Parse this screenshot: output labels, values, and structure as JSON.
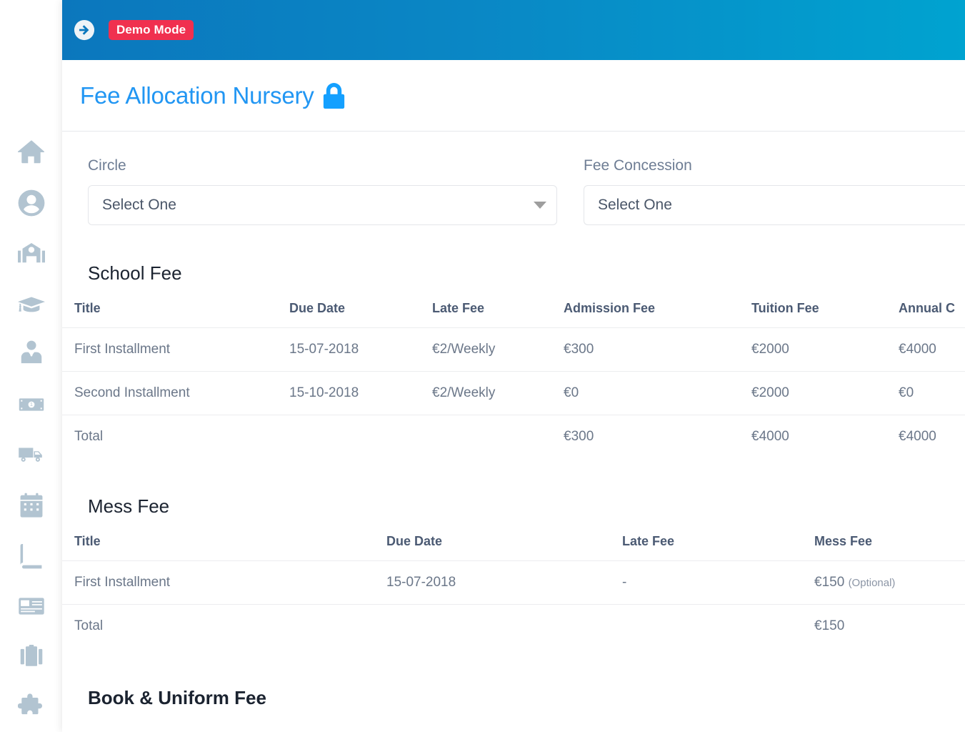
{
  "sidebar": {
    "items": [
      {
        "name": "home",
        "icon": "home-icon"
      },
      {
        "name": "profile",
        "icon": "user-circle-icon"
      },
      {
        "name": "school",
        "icon": "school-building-icon"
      },
      {
        "name": "academics",
        "icon": "graduation-cap-icon"
      },
      {
        "name": "staff",
        "icon": "employee-tie-icon"
      },
      {
        "name": "finance",
        "icon": "money-bill-icon"
      },
      {
        "name": "transport",
        "icon": "truck-icon"
      },
      {
        "name": "calendar",
        "icon": "calendar-icon"
      },
      {
        "name": "library",
        "icon": "book-icon"
      },
      {
        "name": "id-cards",
        "icon": "id-card-icon"
      },
      {
        "name": "inventory",
        "icon": "briefcase-icon"
      },
      {
        "name": "addons",
        "icon": "puzzle-piece-icon"
      }
    ]
  },
  "topbar": {
    "menu_toggle_icon": "arrow-circle-right-icon",
    "demo_badge": "Demo Mode",
    "gradient_start": "#0b77bd",
    "gradient_end": "#00a3d0",
    "badge_color": "#f0304f"
  },
  "header": {
    "title": "Fee Allocation Nursery",
    "title_color": "#2196f3",
    "lock_icon": "lock-icon",
    "lock_color": "#14a0ff"
  },
  "filters": {
    "circle": {
      "label": "Circle",
      "value": "Select One",
      "caret_icon": "chevron-down-icon"
    },
    "fee_concession": {
      "label": "Fee Concession",
      "value": "Select One"
    }
  },
  "school_fee": {
    "title": "School Fee",
    "columns": [
      "Title",
      "Due Date",
      "Late Fee",
      "Admission Fee",
      "Tuition Fee",
      "Annual C"
    ],
    "rows": [
      {
        "title": "First Installment",
        "due_date": "15-07-2018",
        "late_fee": "€2/Weekly",
        "admission_fee": "€300",
        "tuition_fee": "€2000",
        "annual_charges": "€4000"
      },
      {
        "title": "Second Installment",
        "due_date": "15-10-2018",
        "late_fee": "€2/Weekly",
        "admission_fee": "€0",
        "tuition_fee": "€2000",
        "annual_charges": "€0"
      }
    ],
    "total": {
      "title": "Total",
      "due_date": "",
      "late_fee": "",
      "admission_fee": "€300",
      "tuition_fee": "€4000",
      "annual_charges": "€4000"
    }
  },
  "mess_fee": {
    "title": "Mess Fee",
    "columns": [
      "Title",
      "Due Date",
      "Late Fee",
      "Mess Fee"
    ],
    "rows": [
      {
        "title": "First Installment",
        "due_date": "15-07-2018",
        "late_fee": "-",
        "mess_fee": "€150",
        "mess_fee_note": "(Optional)"
      }
    ],
    "total": {
      "title": "Total",
      "due_date": "",
      "late_fee": "",
      "mess_fee": "€150"
    }
  },
  "book_uniform_fee": {
    "title": "Book & Uniform Fee"
  }
}
